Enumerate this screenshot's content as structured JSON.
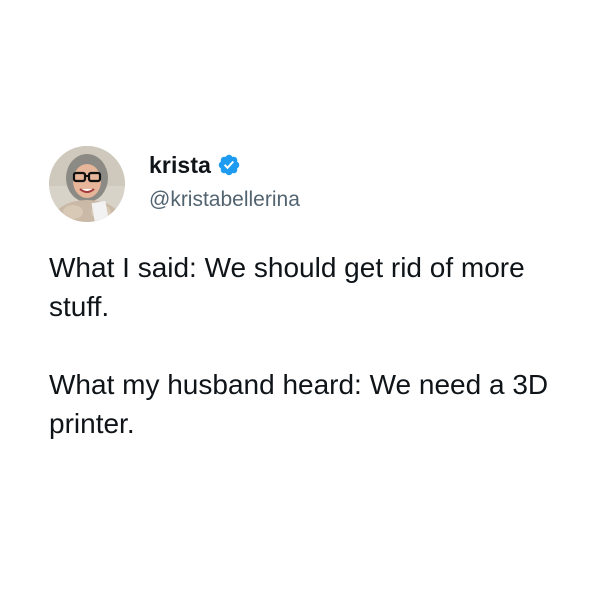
{
  "author": {
    "display_name": "krista",
    "handle": "@kristabellerina",
    "verified": true,
    "avatar_icon": "profile-photo",
    "verified_icon": "verified-badge-icon",
    "verified_color": "#1d9bf0"
  },
  "tweet": {
    "paragraphs": [
      "What I said: We should get rid of more stuff.",
      "What my husband heard: We need a 3D printer."
    ]
  },
  "colors": {
    "text_primary": "#0f1419",
    "text_secondary": "#536471",
    "background": "#ffffff"
  }
}
